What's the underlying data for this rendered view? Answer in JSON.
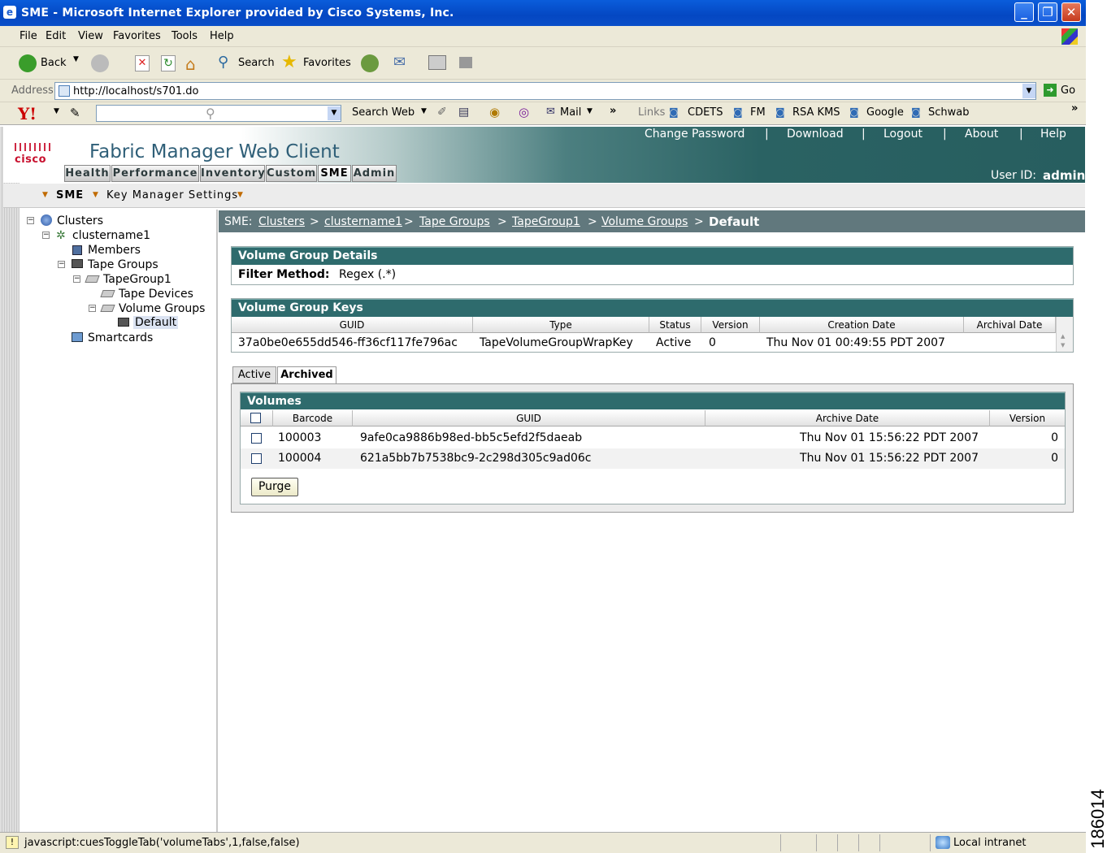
{
  "window": {
    "title": "SME - Microsoft Internet Explorer provided by Cisco Systems, Inc."
  },
  "menu": [
    "File",
    "Edit",
    "View",
    "Favorites",
    "Tools",
    "Help"
  ],
  "toolbar": {
    "back": "Back",
    "search": "Search",
    "favorites": "Favorites"
  },
  "address": {
    "label": "Address",
    "url": "http://localhost/s701.do",
    "go": "Go"
  },
  "yahoo": {
    "search_web": "Search Web",
    "mail": "Mail",
    "links_label": "Links",
    "links": [
      "CDETS",
      "FM",
      "RSA KMS",
      "Google",
      "Schwab"
    ]
  },
  "header": {
    "brand": "cisco",
    "title": "Fabric Manager Web Client",
    "links": [
      "Change Password",
      "Download",
      "Logout",
      "About",
      "Help"
    ],
    "separator": "|",
    "user_label": "User ID:",
    "user": "admin",
    "tabs": [
      "Health",
      "Performance",
      "Inventory",
      "Custom",
      "SME",
      "Admin"
    ]
  },
  "subnav": {
    "item1": "SME",
    "item2": "Key Manager Settings"
  },
  "tree": {
    "clusters": "Clusters",
    "clustername": "clustername1",
    "members": "Members",
    "tape_groups": "Tape Groups",
    "tapegroup": "TapeGroup1",
    "tape_devices": "Tape Devices",
    "volume_groups": "Volume Groups",
    "default": "Default",
    "smartcards": "Smartcards"
  },
  "breadcrumb": {
    "prefix": "SME:",
    "items": [
      "Clusters",
      "clustername1",
      "Tape Groups",
      "TapeGroup1",
      "Volume Groups"
    ],
    "current": "Default",
    "sep": ">"
  },
  "details": {
    "title": "Volume Group Details",
    "filter_label": "Filter Method:",
    "filter_value": "Regex (.*)"
  },
  "keys": {
    "title": "Volume Group Keys",
    "columns": [
      "GUID",
      "Type",
      "Status",
      "Version",
      "Creation Date",
      "Archival Date"
    ],
    "rows": [
      [
        "37a0be0e655dd546-ff36cf117fe796ac",
        "TapeVolumeGroupWrapKey",
        "Active",
        "0",
        "Thu Nov 01 00:49:55 PDT 2007",
        ""
      ]
    ]
  },
  "tabs": {
    "active": "Active",
    "archived": "Archived"
  },
  "volumes": {
    "title": "Volumes",
    "columns": [
      "Barcode",
      "GUID",
      "Archive Date",
      "Version"
    ],
    "rows": [
      [
        "100003",
        "9afe0ca9886b98ed-bb5c5efd2f5daeab",
        "Thu Nov 01 15:56:22 PDT 2007",
        "0"
      ],
      [
        "100004",
        "621a5bb7b7538bc9-2c298d305c9ad06c",
        "Thu Nov 01 15:56:22 PDT 2007",
        "0"
      ]
    ],
    "purge": "Purge"
  },
  "status": {
    "text": "javascript:cuesToggleTab('volumeTabs',1,false,false)",
    "zone": "Local intranet"
  },
  "side_number": "186014"
}
